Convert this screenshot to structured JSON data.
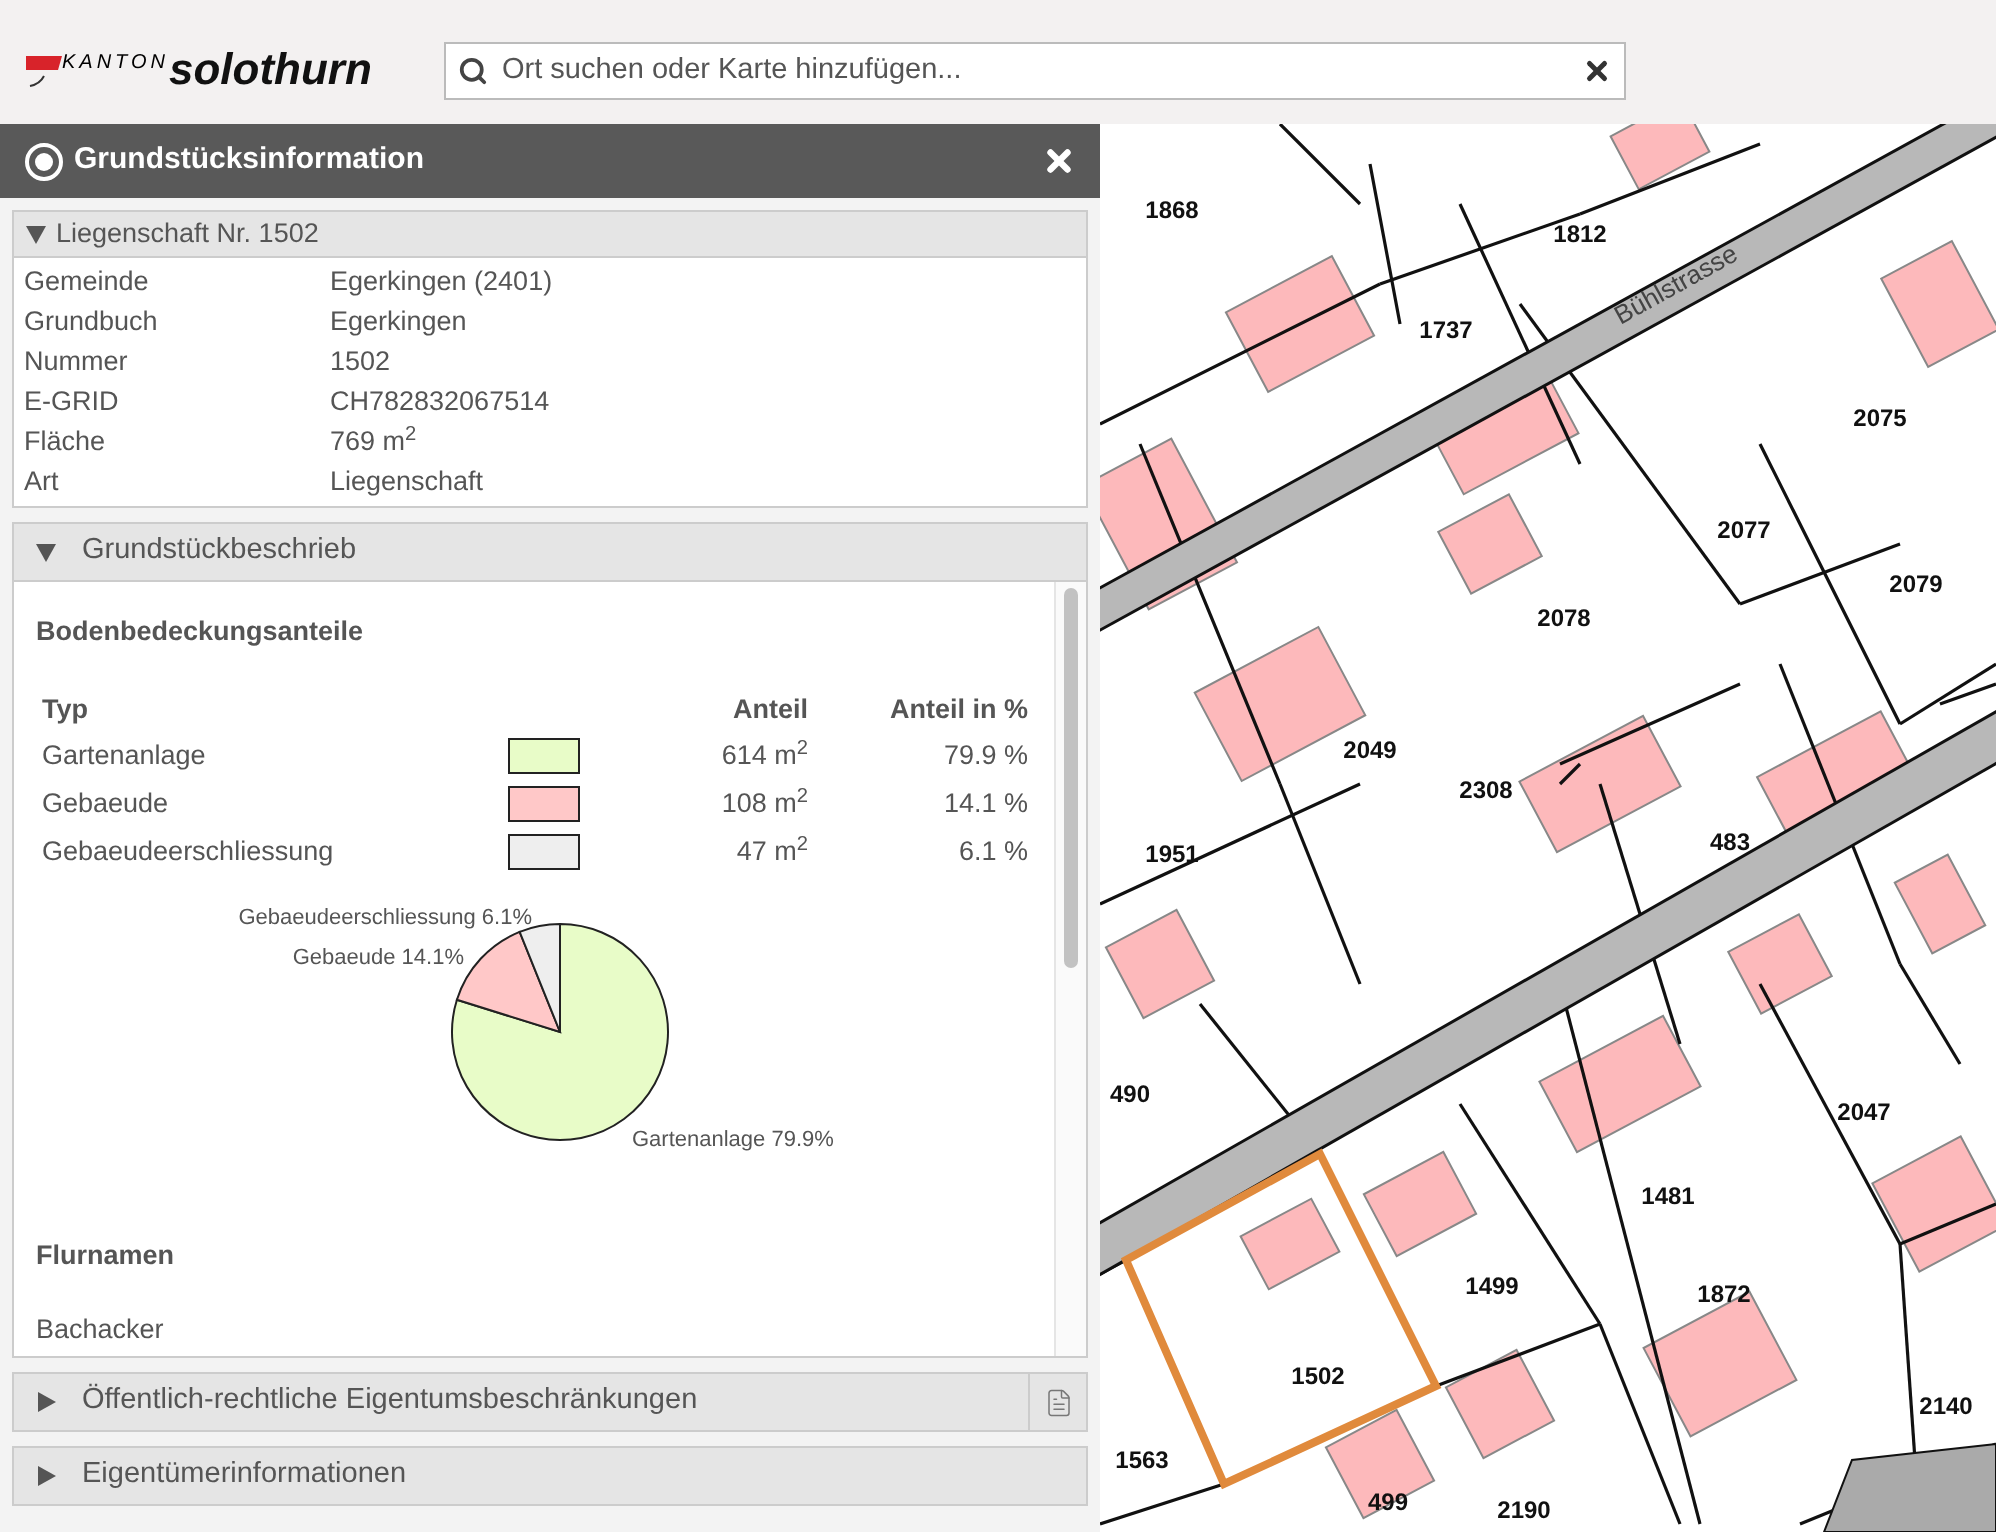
{
  "header": {
    "logo": {
      "small": "KANTON",
      "large": "solothurn"
    },
    "search": {
      "placeholder": "Ort suchen oder Karte hinzufügen..."
    }
  },
  "panel": {
    "title": "Grundstücksinformation",
    "sections": [
      {
        "kind": "property",
        "title": "Liegenschaft Nr. 1502",
        "expanded": true,
        "has_pdf": false,
        "rows": [
          {
            "label": "Gemeinde",
            "value": "Egerkingen (2401)"
          },
          {
            "label": "Grundbuch",
            "value": "Egerkingen"
          },
          {
            "label": "Nummer",
            "value": "1502"
          },
          {
            "label": "E-GRID",
            "value": "CH782832067514"
          },
          {
            "label": "Fläche",
            "value": "769 m$^{2}$"
          },
          {
            "label": "Art",
            "value": "Liegenschaft"
          }
        ]
      },
      {
        "kind": "description",
        "title": "Grundstückbeschrieb",
        "expanded": true,
        "has_pdf": false,
        "heading": "Bodenbedeckungsanteile",
        "columns": [
          "Typ",
          "Anteil",
          "Anteil in %"
        ],
        "rows": [
          {
            "type": "Gartenanlage",
            "color": "#e8fcc8",
            "area": "614 m$^{2}$",
            "percent": "79.9 %"
          },
          {
            "type": "Gebaeude",
            "color": "#ffc8c8",
            "area": "108 m$^{2}$",
            "percent": "14.1 %"
          },
          {
            "type": "Gebaeudeerschliessung",
            "color": "#eeeeee",
            "area": "47 m$^{2}$",
            "percent": "6.1 %"
          }
        ],
        "chart_data": {
          "type": "pie",
          "values": [
            79.9,
            14.1,
            6.1
          ],
          "colors": [
            "#e8fcc8",
            "#ffc8c8",
            "#eeeeee"
          ],
          "annotations": [
            "Gartenanlage 79.9%",
            "Gebaeude 14.1%",
            "Gebaeudeerschliessung 6.1%"
          ]
        },
        "subheading": "Flurnamen",
        "text": "Bachacker"
      },
      {
        "title": "Öffentlich-rechtliche Eigentumsbeschränkungen",
        "expanded": false,
        "has_pdf": true
      },
      {
        "title": "Eigentümerinformationen",
        "expanded": false,
        "has_pdf": false
      }
    ]
  },
  "map": {
    "street": "Bühlstrasse",
    "parcels": [
      "1868",
      "1812",
      "1737",
      "2075",
      "2077",
      "2079",
      "2078",
      "2049",
      "2308",
      "483",
      "1951",
      "2047",
      "490",
      "1481",
      "1499",
      "1872",
      "1502",
      "2140",
      "1563",
      "499",
      "2190"
    ]
  }
}
